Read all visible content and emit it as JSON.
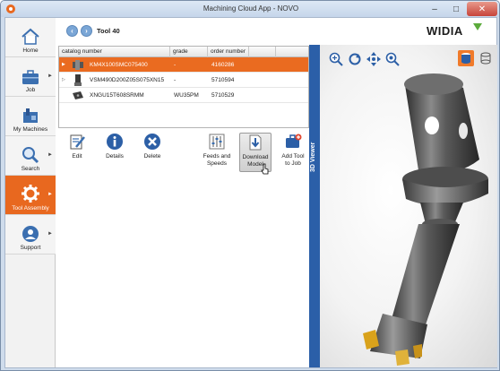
{
  "window": {
    "title": "Machining Cloud App - NOVO",
    "minimize": "–",
    "maximize": "□",
    "close": "✕"
  },
  "sidebar": {
    "items": [
      {
        "label": "Home",
        "icon": "home-icon",
        "active": false,
        "has_arrow": false
      },
      {
        "label": "Job",
        "icon": "briefcase-icon",
        "active": false,
        "has_arrow": true
      },
      {
        "label": "My Machines",
        "icon": "machine-icon",
        "active": false,
        "has_arrow": false
      },
      {
        "label": "Search",
        "icon": "magnifier-icon",
        "active": false,
        "has_arrow": true
      },
      {
        "label": "Tool Assembly",
        "icon": "gear-icon",
        "active": true,
        "has_arrow": true
      },
      {
        "label": "Support",
        "icon": "support-icon",
        "active": false,
        "has_arrow": true
      }
    ],
    "arrow": "►"
  },
  "header": {
    "back": "‹",
    "forward": "›",
    "title": "Tool 40",
    "brand": "WIDIA"
  },
  "table": {
    "columns": [
      "catalog number",
      "grade",
      "order number"
    ],
    "rows": [
      {
        "catalog_number": "KM4X100SMC075400",
        "grade": "-",
        "order_number": "4160286",
        "selected": true,
        "expander": "▶"
      },
      {
        "catalog_number": "VSM490D200Z05S075XN15",
        "grade": "-",
        "order_number": "5710594",
        "selected": false,
        "expander": "▷"
      },
      {
        "catalog_number": "XNGU15T608SRMM",
        "grade": "WU35PM",
        "order_number": "5710529",
        "selected": false,
        "expander": ""
      }
    ]
  },
  "actions": {
    "edit": "Edit",
    "details": "Details",
    "delete": "Delete",
    "feeds_line1": "Feeds and",
    "feeds_line2": "Speeds",
    "download_line1": "Download",
    "download_line2": "Model",
    "add_line1": "Add Tool",
    "add_line2": "to Job"
  },
  "viewer": {
    "label": "3D Viewer",
    "tools": [
      "zoom-in-icon",
      "rotate-icon",
      "pan-icon",
      "zoom-fit-icon"
    ],
    "view_modes": [
      "solid-view-icon",
      "transparent-view-icon"
    ]
  },
  "colors": {
    "accent": "#ea6b20",
    "viewer_tab": "#2b5fa8",
    "nav_button": "#7aa6d6"
  }
}
